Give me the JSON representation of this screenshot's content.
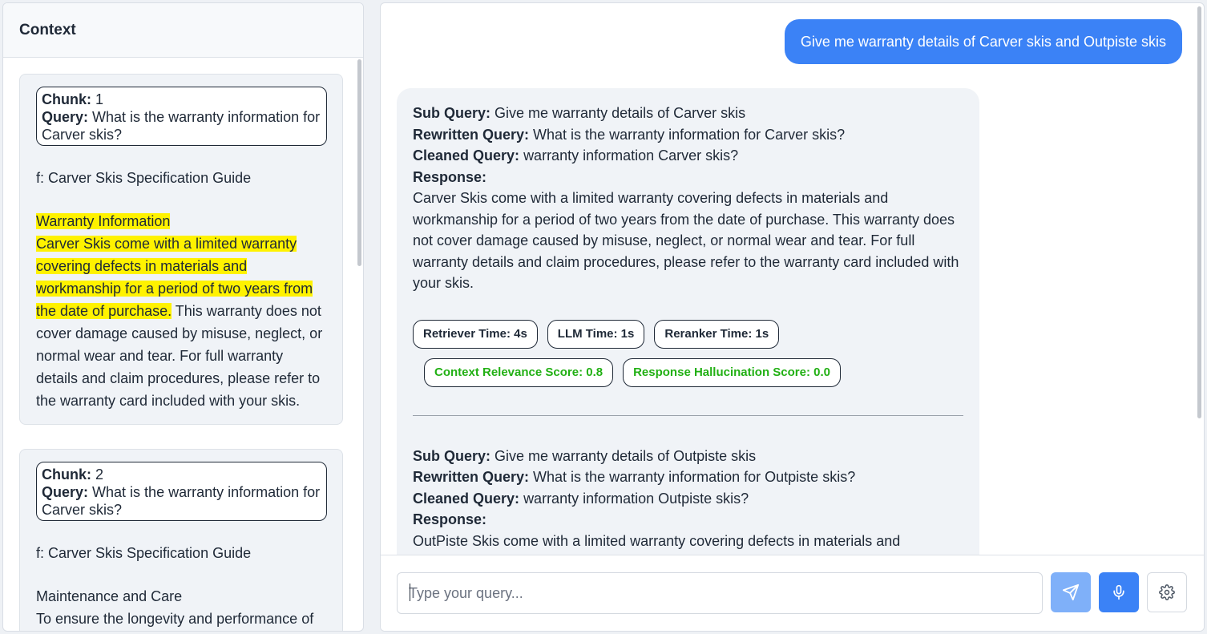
{
  "context": {
    "title": "Context",
    "chunks": [
      {
        "chunk_label": "Chunk:",
        "chunk_number": "1",
        "query_label": "Query:",
        "query": "What is the warranty information for Carver skis?",
        "source": "f: Carver Skis Specification Guide",
        "highlight_heading": "Warranty Information",
        "highlight_text": "Carver Skis come with a limited warranty covering defects in materials and workmanship for a period of two years from the date of purchase.",
        "rest_text": " This warranty does not cover damage caused by misuse, neglect, or normal wear and tear. For full warranty details and claim procedures, please refer to the warranty card included with your skis."
      },
      {
        "chunk_label": "Chunk:",
        "chunk_number": "2",
        "query_label": "Query:",
        "query": "What is the warranty information for Carver skis?",
        "source": "f: Carver Skis Specification Guide",
        "heading": "Maintenance and Care",
        "text": "To ensure the longevity and performance of"
      }
    ]
  },
  "chat": {
    "user_message": "Give me warranty details of Carver skis and Outpiste skis",
    "labels": {
      "sub_query": "Sub Query:",
      "rewritten_query": "Rewritten Query:",
      "cleaned_query": "Cleaned Query:",
      "response": "Response:"
    },
    "answers": [
      {
        "sub_query": "Give me warranty details of Carver skis",
        "rewritten_query": "What is the warranty information for Carver skis?",
        "cleaned_query": "warranty information Carver skis?",
        "response": "Carver Skis come with a limited warranty covering defects in materials and workmanship for a period of two years from the date of purchase. This warranty does not cover damage caused by misuse, neglect, or normal wear and tear. For full warranty details and claim procedures, please refer to the warranty card included with your skis.",
        "metrics": {
          "retriever_time": "Retriever Time: 4s",
          "llm_time": "LLM Time: 1s",
          "reranker_time": "Reranker Time: 1s",
          "context_relevance": "Context Relevance Score: 0.8",
          "hallucination": "Response Hallucination Score: 0.0"
        }
      },
      {
        "sub_query": "Give me warranty details of Outpiste skis",
        "rewritten_query": "What is the warranty information for Outpiste skis?",
        "cleaned_query": "warranty information Outpiste skis?",
        "response": "OutPiste Skis come with a limited warranty covering defects in materials and workmanship for a period of two years from the date of purchase. This warranty does not cover damage caused by misuse, neglect, or normal wear and tear. For full"
      }
    ],
    "input": {
      "placeholder": "Type your query...",
      "value": ""
    }
  },
  "colors": {
    "accent": "#3b82f6",
    "send_disabled": "#7fb0f9",
    "score_green": "#22b014",
    "highlight": "#fff200",
    "card_bg": "#f0f3f7"
  },
  "icons": {
    "send": "send-icon",
    "mic": "microphone-icon",
    "settings": "gear-icon"
  }
}
